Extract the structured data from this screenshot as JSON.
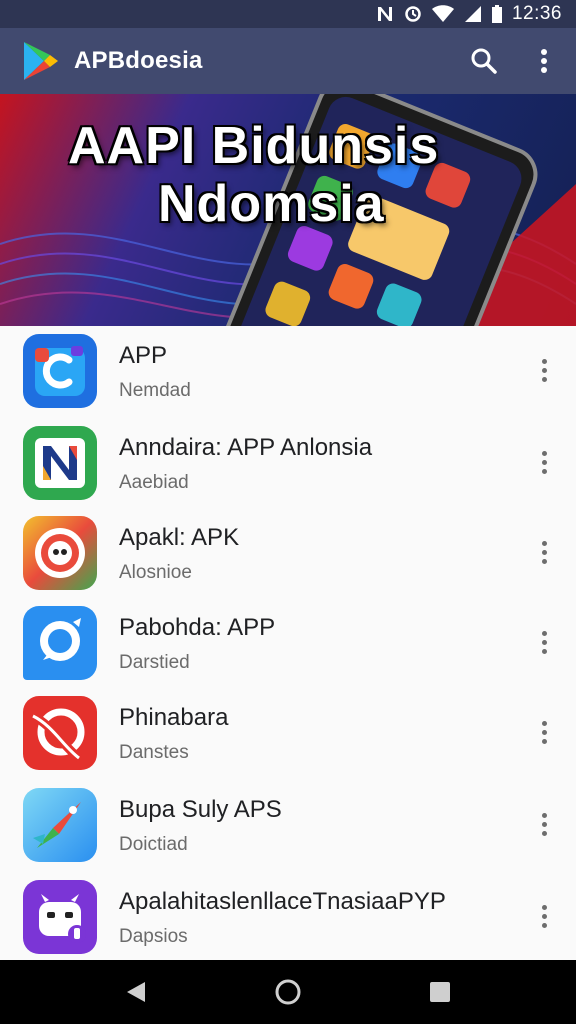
{
  "status_bar": {
    "time": "12:36",
    "icons": [
      "nfc-icon",
      "alarm-icon",
      "wifi-icon",
      "signal-icon",
      "battery-icon"
    ]
  },
  "app_bar": {
    "title": "APBdoesia",
    "logo_icon": "play-store-logo-icon",
    "search_icon": "search-icon",
    "menu_icon": "more-vertical-icon"
  },
  "banner": {
    "line1": "AAPI Bidunsis",
    "line2": "Ndomsia"
  },
  "apps": [
    {
      "name": "APP",
      "subtitle": "Nemdad",
      "icon": "app-icon-blue-c"
    },
    {
      "name": "Anndaira: APP Anlonsia",
      "subtitle": "Aaebiad",
      "icon": "app-icon-green-n"
    },
    {
      "name": "Apakl: APK",
      "subtitle": "Alosnioe",
      "icon": "app-icon-rainbow-circle"
    },
    {
      "name": "Pabohda: APP",
      "subtitle": "Darstied",
      "icon": "app-icon-blue-chat"
    },
    {
      "name": "Phinabara",
      "subtitle": "Danstes",
      "icon": "app-icon-red-swirl"
    },
    {
      "name": "Bupa Suly APS",
      "subtitle": "Doictiad",
      "icon": "app-icon-rocket"
    },
    {
      "name": "ApalahitaslenllaceTnasiaaPYP",
      "subtitle": "Dapsios",
      "icon": "app-icon-purple-robot"
    }
  ],
  "nav": {
    "back_icon": "back-triangle-icon",
    "home_icon": "home-circle-icon",
    "recents_icon": "recents-square-icon"
  },
  "colors": {
    "status_bar": "#2e3553",
    "app_bar": "#414a6f",
    "list_bg": "#fafafa",
    "nav_bar": "#000000"
  }
}
